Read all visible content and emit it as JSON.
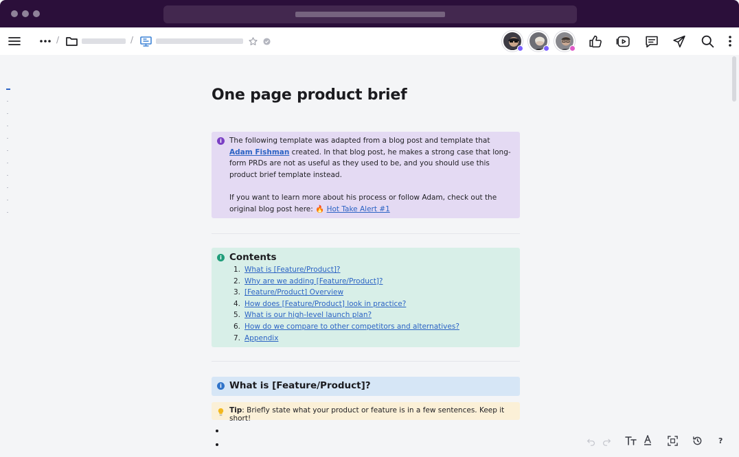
{
  "window": {
    "colors": {
      "titlebar": "#2b0f3a",
      "accent": "#6b3fb8"
    }
  },
  "toolbar": {
    "icons": [
      "menu-icon",
      "more-icon",
      "folder-icon",
      "board-icon",
      "star-icon",
      "verified-icon",
      "like-icon",
      "present-icon",
      "comment-icon",
      "share-icon",
      "search-icon",
      "kebab-icon"
    ],
    "avatars": [
      {
        "name": "avatar-1",
        "status_color": "#7b61ff"
      },
      {
        "name": "avatar-2",
        "status_color": "#7b61ff"
      },
      {
        "name": "avatar-3",
        "status_color": "#e05bc8"
      }
    ]
  },
  "doc": {
    "title": "One page product brief",
    "intro": {
      "p1_before": "The following template was adapted from a blog post and template that ",
      "author_link": "Adam Fishman",
      "p1_after": " created. In that blog post, he makes a strong case that long-form PRDs are not as useful as they used to be, and you should use this product brief template instead.",
      "p2_before": "If you want to learn more about his process or follow Adam, check out the original blog post here: ",
      "post_emoji": "🔥",
      "post_link": "Hot Take Alert #1"
    },
    "contents": {
      "title": "Contents",
      "items": [
        {
          "num": "1.",
          "label": "What is [Feature/Product]?"
        },
        {
          "num": "2.",
          "label": "Why are we adding [Feature/Product]?"
        },
        {
          "num": "3.",
          "label": "[Feature/Product] Overview"
        },
        {
          "num": "4.",
          "label": "How does [Feature/Product] look in practice?"
        },
        {
          "num": "5.",
          "label": "What is our high-level launch plan?"
        },
        {
          "num": "6.",
          "label": "How do we compare to other competitors and alternatives?"
        },
        {
          "num": "7.",
          "label": "Appendix"
        }
      ]
    },
    "section1": {
      "title": "What is [Feature/Product]?",
      "tip_label": "Tip",
      "tip_text": ": Briefly state what your product or feature is in a few sentences. Keep it short!"
    }
  },
  "bottom_toolbar": {
    "icons": [
      "undo-icon",
      "redo-icon",
      "text-size-icon",
      "text-color-icon",
      "fit-screen-icon",
      "history-icon",
      "help-icon"
    ],
    "help": "?"
  }
}
